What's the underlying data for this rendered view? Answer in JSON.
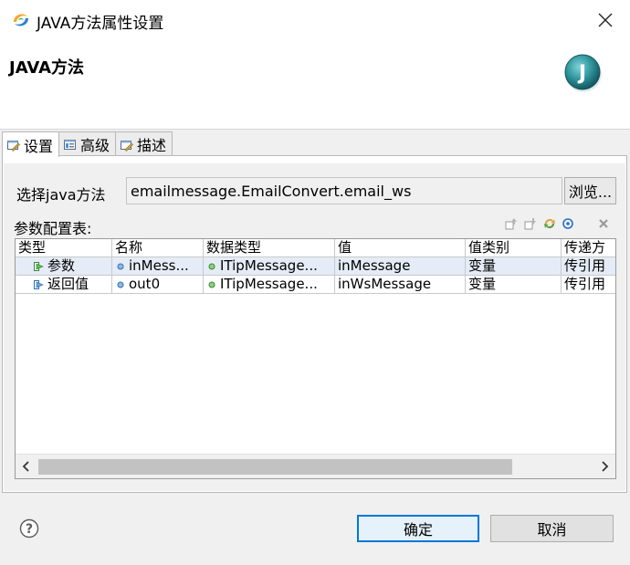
{
  "window": {
    "title": "JAVA方法属性设置",
    "icon": "app-swirl-icon",
    "close_icon": "close-icon"
  },
  "banner": {
    "title": "JAVA方法",
    "logo": "java-j-logo",
    "logo_letter": "J"
  },
  "tabs": [
    {
      "label": "设置",
      "icon": "settings-tab-icon",
      "active": true
    },
    {
      "label": "高级",
      "icon": "advanced-tab-icon",
      "active": false
    },
    {
      "label": "描述",
      "icon": "description-tab-icon",
      "active": false
    }
  ],
  "method": {
    "label": "选择java方法",
    "value": "emailmessage.EmailConvert.email_ws",
    "browse_label": "浏览..."
  },
  "params": {
    "label": "参数配置表:",
    "toolbar_icons": [
      "move-up-icon",
      "move-down-icon",
      "refresh-icon",
      "add-param-icon",
      "delete-icon"
    ],
    "columns": [
      "类型",
      "名称",
      "数据类型",
      "值",
      "值类别",
      "传递方"
    ],
    "rows": [
      {
        "type": "参数",
        "type_icon": "param-in-icon",
        "name": "inMess...",
        "datatype": "ITipMessage...",
        "value": "inMessage",
        "value_kind": "变量",
        "pass": "传引用"
      },
      {
        "type": "返回值",
        "type_icon": "return-out-icon",
        "name": "out0",
        "datatype": "ITipMessage...",
        "value": "inWsMessage",
        "value_kind": "变量",
        "pass": "传引用"
      }
    ]
  },
  "footer": {
    "help_icon": "help-icon",
    "ok_label": "确定",
    "cancel_label": "取消"
  },
  "colors": {
    "accent": "#0078d7",
    "selected_row": "#e5ecf7"
  }
}
